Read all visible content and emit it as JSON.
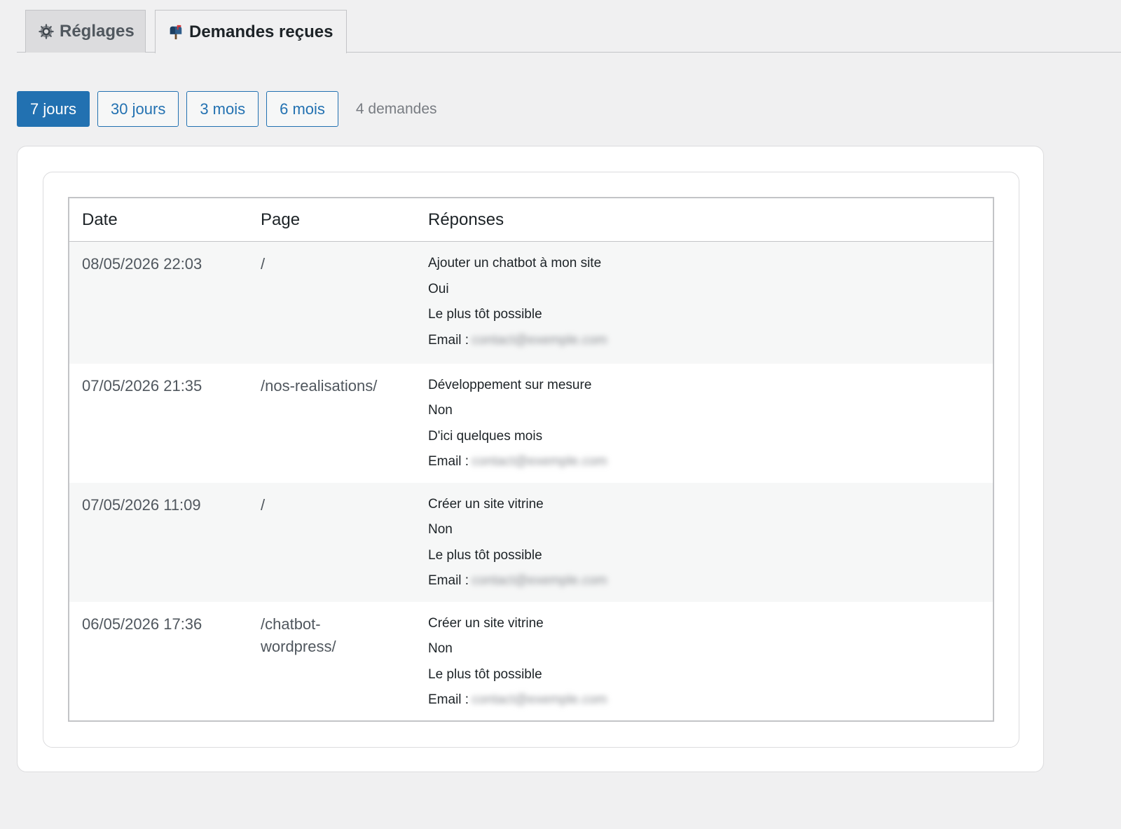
{
  "tabs": [
    {
      "label": "Réglages",
      "icon": "gear-icon",
      "active": false
    },
    {
      "label": "Demandes reçues",
      "icon": "mailbox-icon",
      "active": true
    }
  ],
  "filters": {
    "buttons": [
      {
        "label": "7 jours",
        "selected": true
      },
      {
        "label": "30 jours",
        "selected": false
      },
      {
        "label": "3 mois",
        "selected": false
      },
      {
        "label": "6 mois",
        "selected": false
      }
    ],
    "count_label": "4 demandes"
  },
  "table": {
    "headers": [
      "Date",
      "Page",
      "Réponses"
    ],
    "rows": [
      {
        "date": "08/05/2026 22:03",
        "page": "/",
        "responses": [
          "Ajouter un chatbot à mon site",
          "Oui",
          "Le plus tôt possible"
        ],
        "email_label": "Email :",
        "email_value": "contact@exemple.com"
      },
      {
        "date": "07/05/2026 21:35",
        "page": "/nos-realisations/",
        "responses": [
          "Développement sur mesure",
          "Non",
          "D'ici quelques mois"
        ],
        "email_label": "Email :",
        "email_value": "contact@exemple.com"
      },
      {
        "date": "07/05/2026 11:09",
        "page": "/",
        "responses": [
          "Créer un site vitrine",
          "Non",
          "Le plus tôt possible"
        ],
        "email_label": "Email :",
        "email_value": "contact@exemple.com"
      },
      {
        "date": "06/05/2026 17:36",
        "page": "/chatbot-wordpress/",
        "responses": [
          "Créer un site vitrine",
          "Non",
          "Le plus tôt possible"
        ],
        "email_label": "Email :",
        "email_value": "contact@exemple.com"
      }
    ]
  },
  "colors": {
    "accent": "#2271b1",
    "background": "#f0f0f1",
    "stripe": "#f6f7f7"
  }
}
